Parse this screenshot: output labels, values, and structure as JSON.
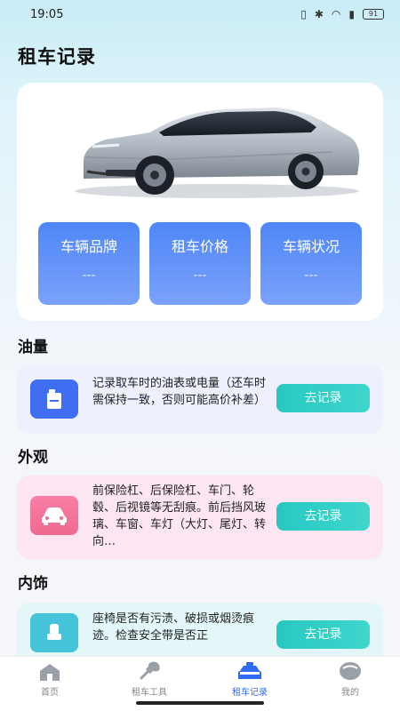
{
  "status_bar": {
    "time": "19:05",
    "battery": "91"
  },
  "page": {
    "title": "租车记录"
  },
  "stats": [
    {
      "title": "车辆品牌",
      "value": "---"
    },
    {
      "title": "租车价格",
      "value": "---"
    },
    {
      "title": "车辆状况",
      "value": "---"
    }
  ],
  "sections": {
    "fuel": {
      "title": "油量",
      "description": "记录取车时的油表或电量（还车时需保持一致，否则可能高价补差）",
      "button": "去记录",
      "icon": "fuel-can-icon"
    },
    "exterior": {
      "title": "外观",
      "description": "前保险杠、后保险杠、车门、轮毂、后视镜等无刮痕。前后挡风玻璃、车窗、车灯（大灯、尾灯、转向…",
      "button": "去记录",
      "icon": "car-front-icon"
    },
    "interior": {
      "title": "内饰",
      "description": "座椅是否有污渍、破损或烟烫痕迹。检查安全带是否正",
      "button": "去记录",
      "icon": "car-seat-icon"
    }
  },
  "tab_bar": {
    "tabs": [
      {
        "label": "首页",
        "icon": "home-icon",
        "active": false
      },
      {
        "label": "租车工具",
        "icon": "wrench-icon",
        "active": false
      },
      {
        "label": "租车记录",
        "icon": "car-icon",
        "active": true
      },
      {
        "label": "我的",
        "icon": "profile-icon",
        "active": false
      }
    ]
  },
  "colors": {
    "accent_blue": "#4f86f6",
    "accent_teal": "#27c8c1",
    "active_tab": "#2f6cf3"
  }
}
